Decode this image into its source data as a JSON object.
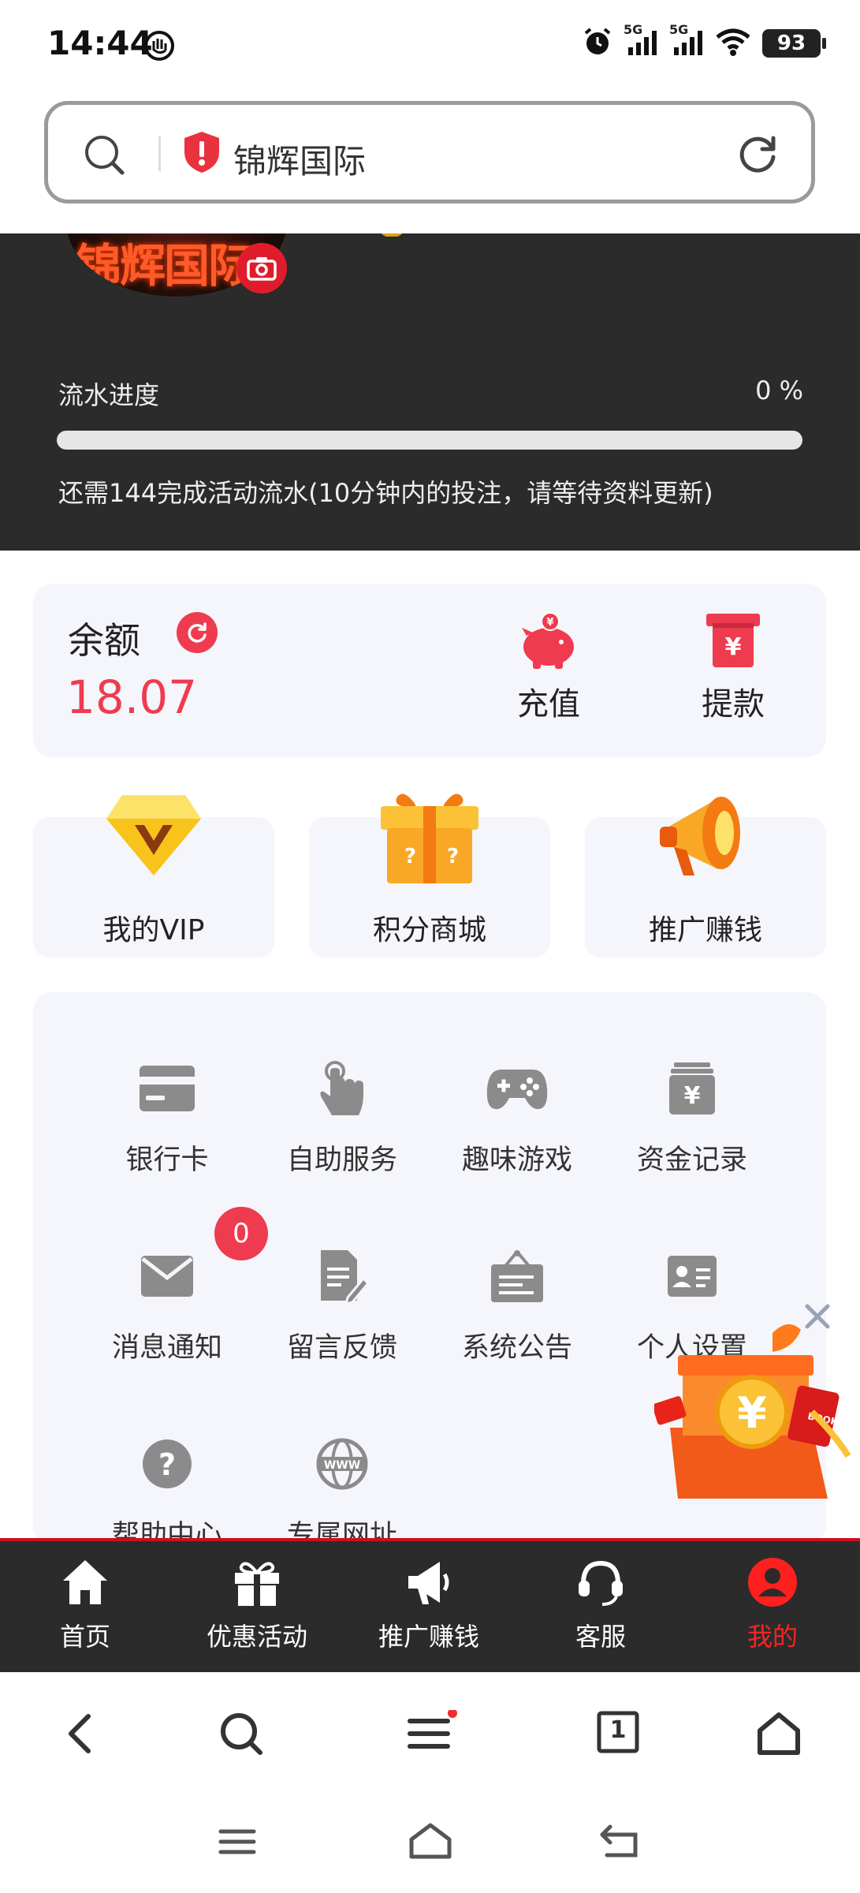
{
  "status": {
    "time": "14:44",
    "battery": "93",
    "net1": "5G",
    "net2": "5G"
  },
  "address": {
    "url_text": "锦辉国际"
  },
  "header": {
    "avatar_text": "锦辉国际",
    "progress_label": "流水进度",
    "progress_value": "0 %",
    "progress_fraction": 0,
    "progress_note": "还需144完成活动流水(10分钟内的投注，请等待资料更新)"
  },
  "balance": {
    "label": "余额",
    "amount": "18.07",
    "recharge": "充值",
    "withdraw": "提款"
  },
  "tiles": {
    "vip": "我的VIP",
    "points": "积分商城",
    "promote": "推广赚钱"
  },
  "grid": {
    "bank_card": "银行卡",
    "self_service": "自助服务",
    "fun_games": "趣味游戏",
    "fund_records": "资金记录",
    "messages": "消息通知",
    "messages_badge": "0",
    "feedback": "留言反馈",
    "announcements": "系统公告",
    "personal_settings": "个人设置",
    "help_center": "帮助中心",
    "exclusive_url": "专属网址"
  },
  "bottom_nav": {
    "home": "首页",
    "promotions": "优惠活动",
    "promote": "推广赚钱",
    "service": "客服",
    "mine": "我的"
  },
  "browser": {
    "tab_count": "1"
  },
  "colors": {
    "accent": "#ef3b4f",
    "dark": "#2b2b2b",
    "active_nav": "#ff2222"
  }
}
